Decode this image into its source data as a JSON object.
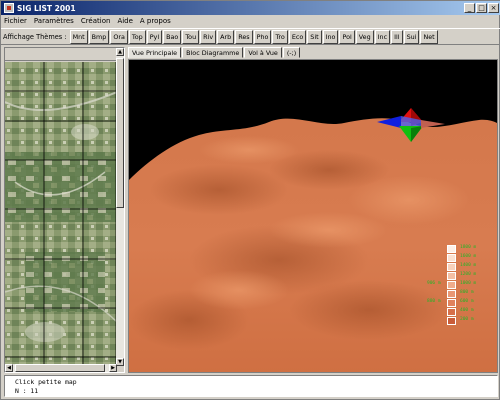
{
  "window": {
    "title": "SIG LIST 2001",
    "buttons": {
      "minimize": "_",
      "maximize": "□",
      "close": "×"
    }
  },
  "menu": {
    "items": [
      "Fichier",
      "Paramètres",
      "Création",
      "Aide",
      "A propos"
    ]
  },
  "themes": {
    "label": "Affichage Thèmes :",
    "buttons": [
      "Mnt",
      "Bmp",
      "Ora",
      "Top",
      "Pyl",
      "Bao",
      "Tou",
      "Riv",
      "Arb",
      "Res",
      "Pho",
      "Tro",
      "Eco",
      "Sit",
      "Ino",
      "Pol",
      "Veg",
      "Inc",
      "Ill",
      "Sui",
      "Net"
    ]
  },
  "tabs": {
    "items": [
      "Vue Principale",
      "Bloc Diagramme",
      "Vol à Vue",
      "(-;)"
    ],
    "active": "Vue Principale"
  },
  "legend": {
    "entries": [
      {
        "value": "1800 m",
        "color": "#fdf0e8"
      },
      {
        "value": "1600 m",
        "color": "#fbe2d2"
      },
      {
        "value": "1400 m",
        "color": "#f8d2bc"
      },
      {
        "value": "1200 m",
        "color": "#f4c0a4"
      },
      {
        "value": "1000 m",
        "color": "#efac8c"
      },
      {
        "value": "800 m",
        "color": "#e99774"
      },
      {
        "value": "600 m",
        "color": "#e0825e"
      },
      {
        "value": "400 m",
        "color": "#d66f4a"
      },
      {
        "value": "200 m",
        "color": "#c95d3a"
      }
    ],
    "markers": [
      "906 m",
      "880 m"
    ]
  },
  "colors": {
    "terrain": "#d8784a",
    "sky": "#000000",
    "legend_text": "#28b428",
    "arrow_red": "#e01010",
    "arrow_green": "#10c010",
    "arrow_blue": "#1020e0"
  },
  "status": {
    "line1": "Click petite map",
    "line2": "N : 11"
  }
}
